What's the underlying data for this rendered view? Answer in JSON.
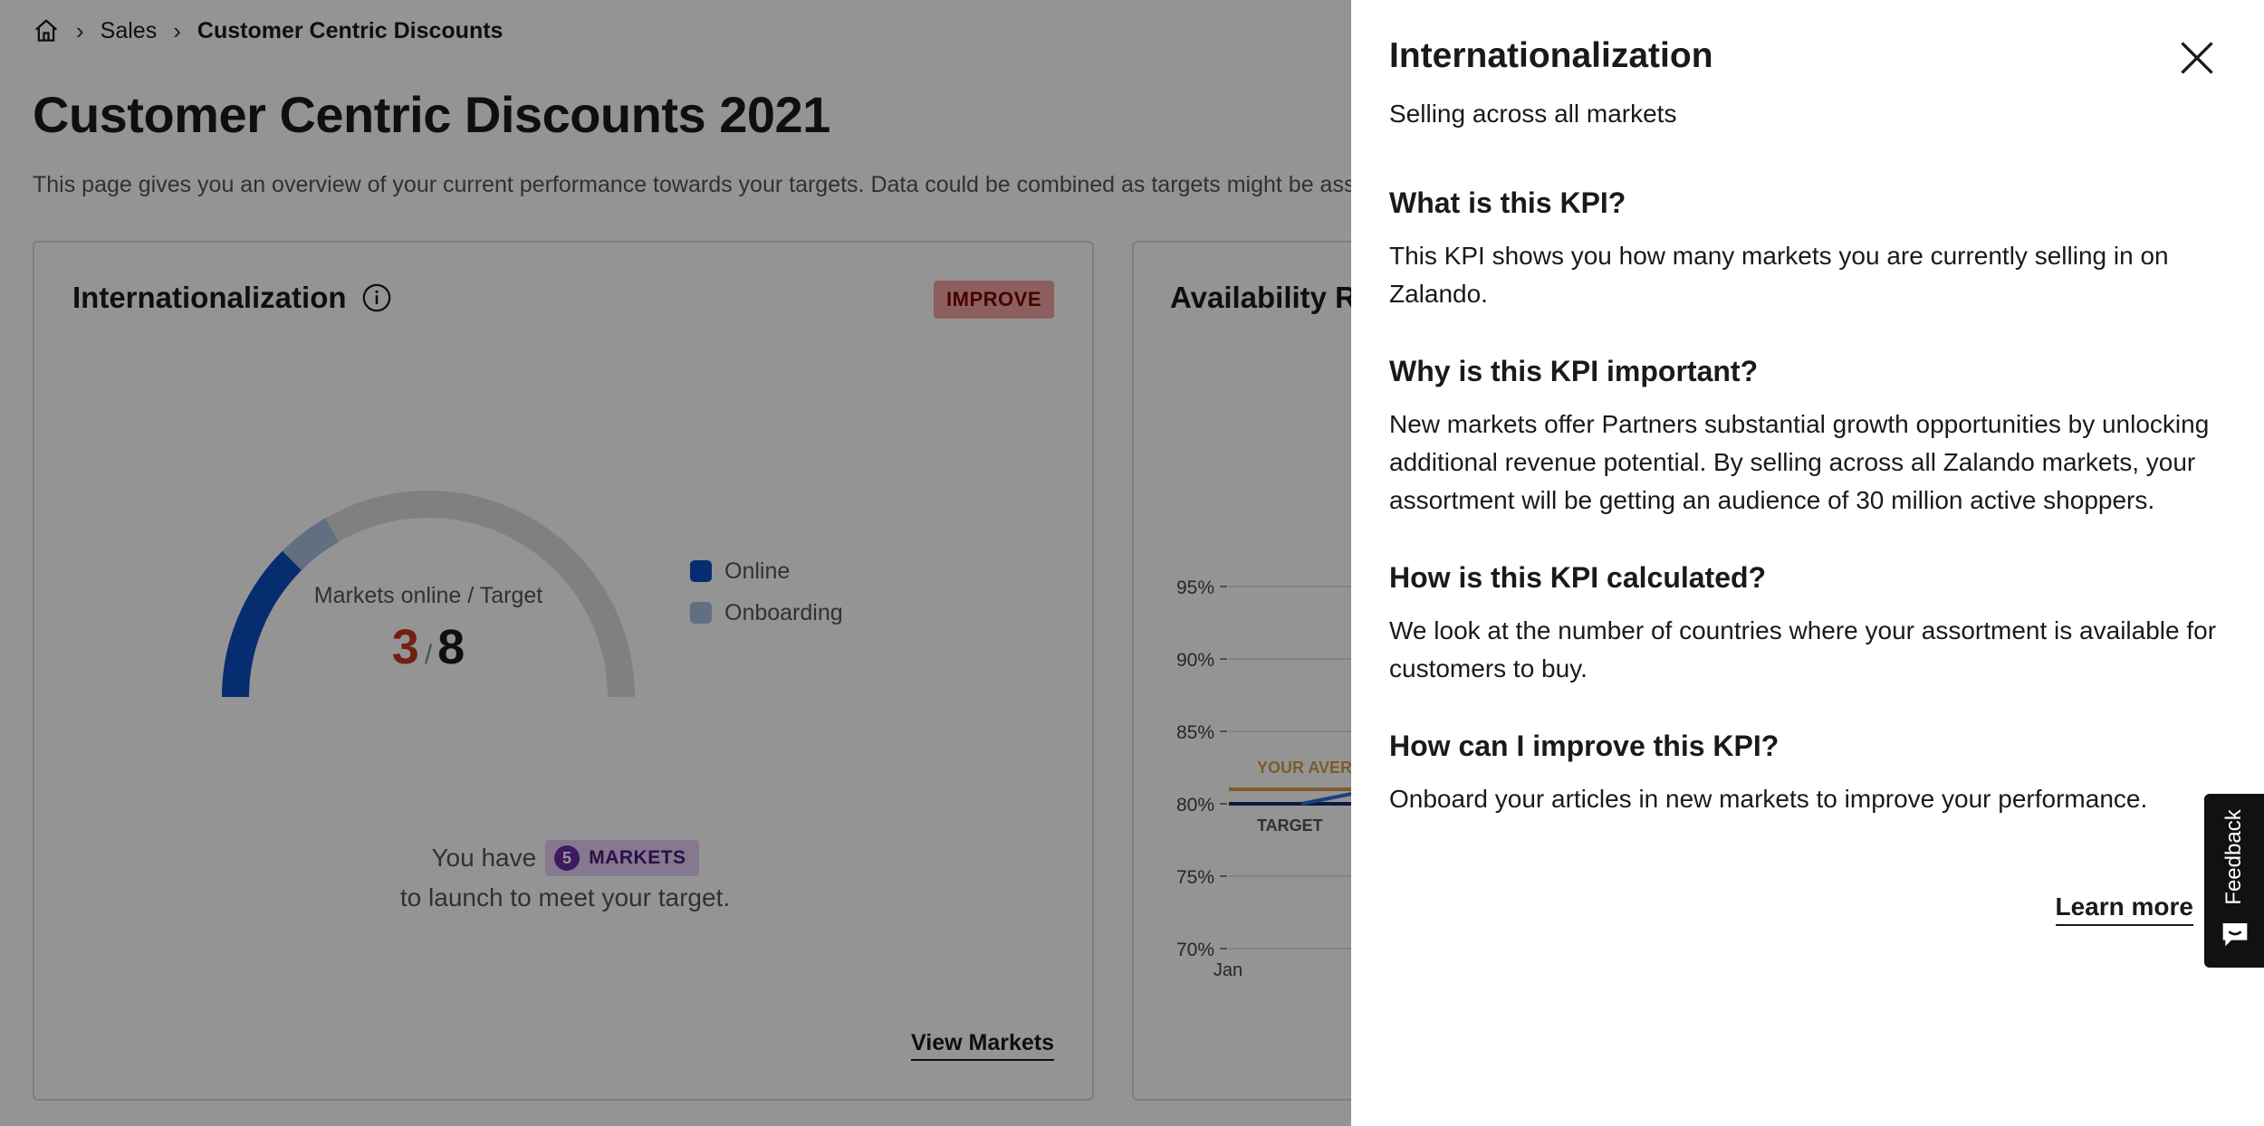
{
  "breadcrumb": {
    "items": [
      "Sales",
      "Customer Centric Discounts"
    ]
  },
  "page": {
    "title": "Customer Centric Discounts 2021",
    "description": "This page gives you an overview of your current performance towards your targets. Data could be combined as targets might be assig"
  },
  "internationalization_card": {
    "title": "Internationalization",
    "status_badge": "IMPROVE",
    "gauge_label": "Markets online / Target",
    "online_value": "3",
    "slash": "/",
    "target_value": "8",
    "online_fraction": 0.25,
    "onboarding_fraction": 0.083,
    "legend": [
      {
        "label": "Online",
        "color": "#0b4fbf"
      },
      {
        "label": "Onboarding",
        "color": "#a9c0df"
      }
    ],
    "remaining_prefix": "You have",
    "remaining_count": "5",
    "remaining_unit": "MARKETS",
    "remaining_suffix": "to launch to meet your target.",
    "link_label": "View Markets"
  },
  "availability_card": {
    "title": "Availability Ra",
    "chart_data": {
      "type": "line",
      "y_tick_labels": [
        "95%",
        "90%",
        "85%",
        "80%",
        "75%",
        "70%"
      ],
      "x_tick_labels": [
        "Jan"
      ],
      "ylim": [
        70,
        95
      ],
      "annotations": [
        "YOUR AVERA",
        "TARGET"
      ],
      "series": [
        {
          "name": "YOUR AVERA",
          "color": "#d6a04a",
          "values": [
            81,
            81
          ]
        },
        {
          "name": "TARGET",
          "color": "#1b2a6b",
          "values": [
            80,
            80
          ]
        },
        {
          "color": "#2f6fd6",
          "values": [
            80,
            80.8
          ]
        }
      ]
    }
  },
  "drawer": {
    "title": "Internationalization",
    "subtitle": "Selling across all markets",
    "sections": [
      {
        "heading": "What is this KPI?",
        "body": "This KPI shows you how many markets you are currently selling in on Zalando."
      },
      {
        "heading": "Why is this KPI important?",
        "body": "New markets offer Partners substantial growth opportunities by unlocking additional revenue potential. By selling across all Zalando markets, your assortment will be getting an audience of 30 million active shoppers."
      },
      {
        "heading": "How is this KPI calculated?",
        "body": "We look at the number of countries where your assortment is available for customers to buy."
      },
      {
        "heading": "How can I improve this KPI?",
        "body": "Onboard your articles in new markets to improve your performance."
      }
    ],
    "learn_more": "Learn more"
  },
  "feedback": {
    "label": "Feedback"
  },
  "icons": {
    "home": "home-icon",
    "chevron": "chevron-right-icon",
    "info": "info-icon",
    "close": "close-icon",
    "feedback": "chat-icon"
  }
}
